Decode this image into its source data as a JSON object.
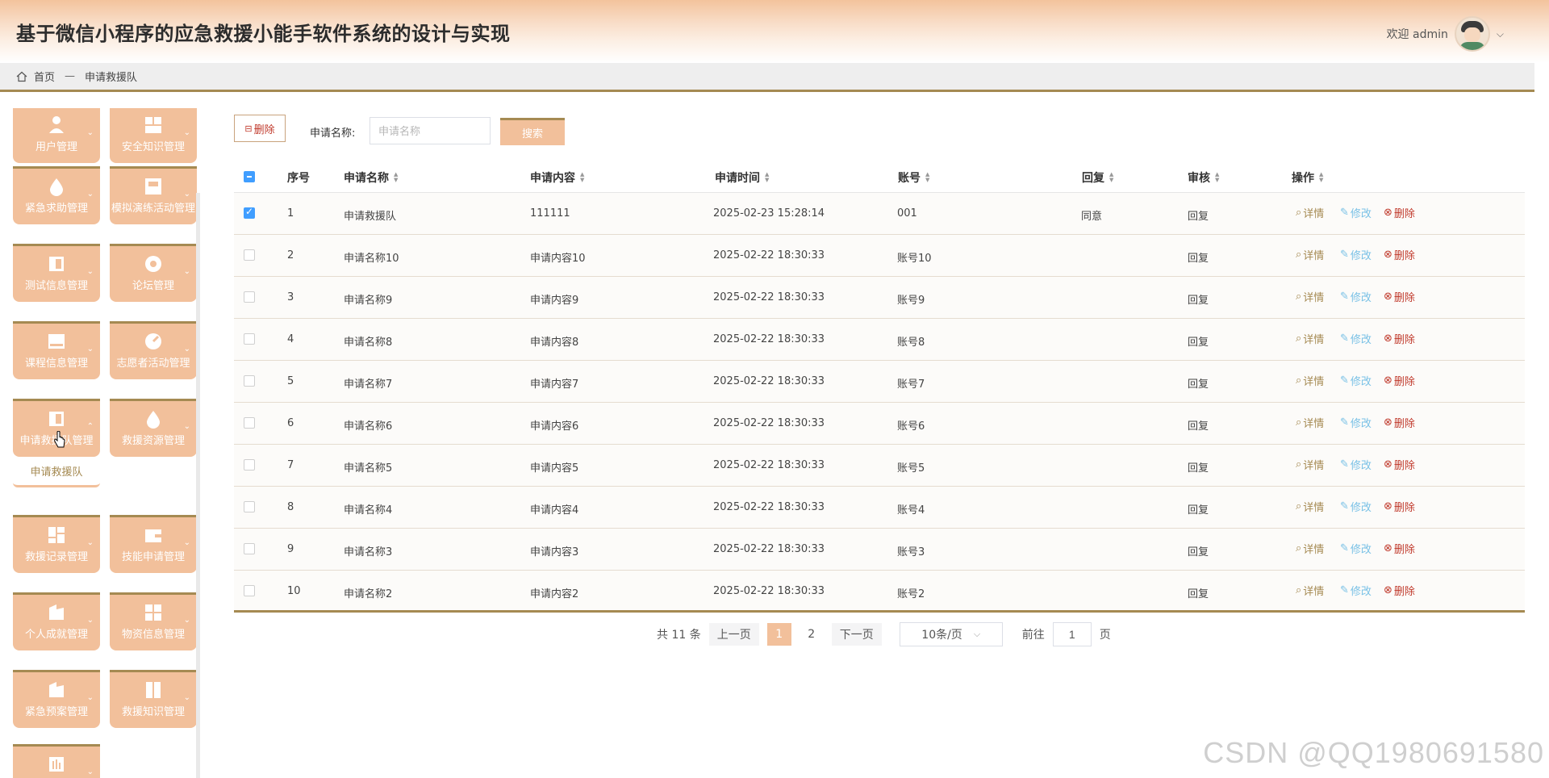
{
  "header": {
    "title": "基于微信小程序的应急救援小能手软件系统的设计与实现",
    "welcome": "欢迎 admin"
  },
  "breadcrumb": {
    "home": "首页",
    "separator": "—",
    "current": "申请救援队"
  },
  "sidebar": {
    "items": [
      {
        "label": "用户管理",
        "icon": "user-icon"
      },
      {
        "label": "安全知识管理",
        "icon": "grid-icon"
      },
      {
        "label": "紧急求助管理",
        "icon": "drop-icon"
      },
      {
        "label": "模拟演练活动管理",
        "icon": "shop-icon"
      },
      {
        "label": "测试信息管理",
        "icon": "panel-icon"
      },
      {
        "label": "论坛管理",
        "icon": "circle-icon"
      },
      {
        "label": "课程信息管理",
        "icon": "drive-icon"
      },
      {
        "label": "志愿者活动管理",
        "icon": "gauge-icon"
      },
      {
        "label": "申请救援队管理",
        "icon": "panel-icon"
      },
      {
        "label": "救援资源管理",
        "icon": "drop-icon"
      },
      {
        "label": "救援记录管理",
        "icon": "grid-icon"
      },
      {
        "label": "技能申请管理",
        "icon": "wallet-icon"
      },
      {
        "label": "个人成就管理",
        "icon": "folder-icon"
      },
      {
        "label": "物资信息管理",
        "icon": "grid-icon"
      },
      {
        "label": "紧急预案管理",
        "icon": "folder-icon"
      },
      {
        "label": "救援知识管理",
        "icon": "book-icon"
      },
      {
        "label": "",
        "icon": "chart-icon"
      }
    ],
    "submenu": {
      "label": "申请救援队"
    }
  },
  "toolbar": {
    "delete_label": "删除",
    "search_label": "申请名称:",
    "search_placeholder": "申请名称",
    "search_value": "",
    "search_button": "搜索"
  },
  "table": {
    "headers": [
      "序号",
      "申请名称",
      "申请内容",
      "申请时间",
      "账号",
      "回复",
      "审核",
      "操作"
    ],
    "actions": {
      "detail": "详情",
      "edit": "修改",
      "delete": "删除"
    },
    "rows": [
      {
        "no": "1",
        "name": "申请救援队",
        "content": "111111",
        "time": "2025-02-23 15:28:14",
        "account": "001",
        "reply": "同意",
        "audit": "回复",
        "checked": true
      },
      {
        "no": "2",
        "name": "申请名称10",
        "content": "申请内容10",
        "time": "2025-02-22 18:30:33",
        "account": "账号10",
        "reply": "",
        "audit": "回复",
        "checked": false
      },
      {
        "no": "3",
        "name": "申请名称9",
        "content": "申请内容9",
        "time": "2025-02-22 18:30:33",
        "account": "账号9",
        "reply": "",
        "audit": "回复",
        "checked": false
      },
      {
        "no": "4",
        "name": "申请名称8",
        "content": "申请内容8",
        "time": "2025-02-22 18:30:33",
        "account": "账号8",
        "reply": "",
        "audit": "回复",
        "checked": false
      },
      {
        "no": "5",
        "name": "申请名称7",
        "content": "申请内容7",
        "time": "2025-02-22 18:30:33",
        "account": "账号7",
        "reply": "",
        "audit": "回复",
        "checked": false
      },
      {
        "no": "6",
        "name": "申请名称6",
        "content": "申请内容6",
        "time": "2025-02-22 18:30:33",
        "account": "账号6",
        "reply": "",
        "audit": "回复",
        "checked": false
      },
      {
        "no": "7",
        "name": "申请名称5",
        "content": "申请内容5",
        "time": "2025-02-22 18:30:33",
        "account": "账号5",
        "reply": "",
        "audit": "回复",
        "checked": false
      },
      {
        "no": "8",
        "name": "申请名称4",
        "content": "申请内容4",
        "time": "2025-02-22 18:30:33",
        "account": "账号4",
        "reply": "",
        "audit": "回复",
        "checked": false
      },
      {
        "no": "9",
        "name": "申请名称3",
        "content": "申请内容3",
        "time": "2025-02-22 18:30:33",
        "account": "账号3",
        "reply": "",
        "audit": "回复",
        "checked": false
      },
      {
        "no": "10",
        "name": "申请名称2",
        "content": "申请内容2",
        "time": "2025-02-22 18:30:33",
        "account": "账号2",
        "reply": "",
        "audit": "回复",
        "checked": false
      }
    ]
  },
  "pagination": {
    "total": "共 11 条",
    "prev": "上一页",
    "pages": [
      "1",
      "2"
    ],
    "current": "1",
    "next": "下一页",
    "page_size": "10条/页",
    "goto_label": "前往",
    "goto_value": "1",
    "goto_suffix": "页"
  },
  "watermark": "CSDN @QQ1980691580",
  "colors": {
    "accent": "#f2c09b",
    "border": "#a58a52",
    "delete": "#c0392b",
    "edit": "#79c1e6",
    "checkbox": "#409eff"
  }
}
